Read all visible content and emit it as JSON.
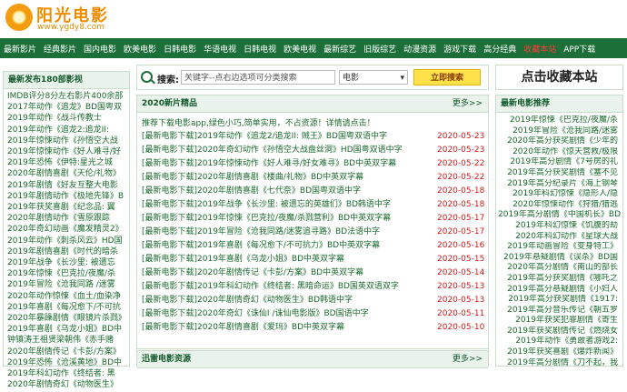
{
  "header": {
    "logo_title": "阳光电影",
    "logo_url": "www.ygdy8.com"
  },
  "nav": {
    "items": [
      "最新影片",
      "经典影片",
      "国内电影",
      "欧美电影",
      "日韩电影",
      "华语电视",
      "日韩电视",
      "欧美电视",
      "最新综艺",
      "旧版综艺",
      "动漫资源",
      "游戏下载",
      "高分经典",
      "收藏本站",
      "APP下载"
    ],
    "hot_index": 13
  },
  "left": {
    "title": "最新发布180部影视",
    "items": [
      "IMDB评分8分左右影片400余部",
      "2017年动作《追龙》BD国粤双",
      "2019年动作《战斗传教士",
      "2019年动作《追龙2:追龙II:",
      "2019年惊悚动作《孙悟空大战",
      "2019年惊悚动作《好人难寻/好",
      "2019年恐怖《伊特:星光之城",
      "2020年剧情喜剧《天伦/礼物》",
      "2019年剧情《好友互整大电影",
      "2019年剧情动作《极地先锋》B",
      "2019年获奖喜剧《纪念品: 翼",
      "2020年剧情动作《雪原跟踪",
      "2020年奇幻动画《魔发精灵2》",
      "2019年动作《刺杀风云》HD国",
      "2019年剧情喜剧《时代的暗杀",
      "2019年战争《长沙里: 被遗忘",
      "2019年惊悚《巴克拉/夜魔/杀",
      "2019年冒险《沧我同路 /迷雾",
      "2020年动作惊悚《血土/血染净",
      "2019年喜剧《每况愈下/不可抗",
      "2020年暴躁剧情《眼镜片杀戮》BD",
      "2019年喜剧《乌龙小姐》BD中",
      "钟镇涛王祖贤梁朝伟《赤手赌",
      "2020年剧情传记《卡彭/方案》",
      "2019年恐怖《沧溪黄地》BD中",
      "2019年科幻动作《终结者: 黑",
      "2020年剧情奇幻《动物医生》"
    ]
  },
  "search": {
    "label": "搜索:",
    "placeholder": "关键字--点右边选项可分类搜索",
    "category": "电影",
    "button": "立即搜索"
  },
  "fav": {
    "label": "点击收藏本站"
  },
  "main": {
    "title": "2020新片精品",
    "more": "更多>>",
    "notice": "推荐下载电影app,绿色小巧,简单实用，不占资源！详情请点击！",
    "rows": [
      {
        "title": "[最新电影下载]2019年动作《追龙2/追龙II: 贼王》BD国粤双语中字",
        "date": "2020-05-23"
      },
      {
        "title": "[最新电影下载]2020年奇幻动作《孙悟空大战盘丝洞》HD国粤双语中字",
        "date": "2020-05-23"
      },
      {
        "title": "[最新电影下载]2019年惊悚动作《好人难寻/好女难寻》BD中英双字幕",
        "date": "2020-05-22"
      },
      {
        "title": "[最新电影下载]2020年剧情喜剧《楼曲/礼物》BD中英双字幕",
        "date": "2020-05-22"
      },
      {
        "title": "[最新电影下载]2020年剧情喜剧《七代奈》BD国粤双语中字",
        "date": "2020-05-18"
      },
      {
        "title": "[最新电影下载]2019年战争《长沙里: 被遗忘的英雄们》BD韩语中字",
        "date": "2020-05-18"
      },
      {
        "title": "[最新电影下载]2019年惊悚《巴克拉/夜魔/杀戮营利》BD中英双字幕",
        "date": "2020-05-17"
      },
      {
        "title": "[最新电影下载]2019年冒险《沧我同路/迷雾追寻路》BD法语中字",
        "date": "2020-05-17"
      },
      {
        "title": "[最新电影下载]2019年喜剧《每况愈下/不可抗力》BD中英双字幕",
        "date": "2020-05-16"
      },
      {
        "title": "[最新电影下载]2019年喜剧《乌龙小姐》BD中英双字幕",
        "date": "2020-05-15"
      },
      {
        "title": "[最新电影下载]2020年剧情传记《卡彭/方案》BD中英双字幕",
        "date": "2020-05-14"
      },
      {
        "title": "[最新电影下载]2019年科幻动作《终结者: 黑暗命运》BD国英双语双字",
        "date": "2020-05-13"
      },
      {
        "title": "[最新电影下载]2020年剧情奇幻《动物医生》BD韩语中字",
        "date": "2020-05-13"
      },
      {
        "title": "[最新电影下载]2020年奇幻《诛仙I /诛仙电影版》BD国语中字",
        "date": "2020-05-11"
      },
      {
        "title": "[最新电影下载]2020年剧情喜剧《爱玛》BD中英双字幕",
        "date": "2020-05-10"
      }
    ]
  },
  "section2": {
    "title": "迅雷电影资源",
    "more": "更多>>"
  },
  "right": {
    "title": "最新电影推荐",
    "items": [
      "2019年惊悚《巴克拉/夜魔/杀",
      "2019年冒险《沧我同路/迷雾",
      "2020年高分获奖剧情《少年的",
      "2020年动作《惊天营救/极限",
      "2019年高分剧情《7号房的礼",
      "2019年高分获奖剧情《塞不见",
      "2019年高分纪录片《海上钢琴",
      "2019年科幻惊悚《隐形人/隐",
      "2020年惊悚动作《狩猎/猎逃",
      "2019年高分剧情《中国机长》BD",
      "2019年科幻惊悚《饥腹的劫",
      "2020年科幻动作《星球大战",
      "2019年动画冒险《变身特工》",
      "2019年悬疑剧情《误杀》BD国",
      "2020年高分剧情《南山的部长",
      "2019年高分获奖剧情《哪吒之",
      "2019年高分悬疑剧情《小妇人",
      "2019年高分获奖剧情《1917:",
      "2019年高分音乐传记《朝五罗",
      "2019年获奖犯罪剧情《寄生",
      "2019年获奖剧情传记《燃烧女",
      "2019年动作《勇敢者游戏2:",
      "2019年获奖喜剧《爆炸新闻》",
      "2019年高分剧情《刀不起，我"
    ]
  }
}
